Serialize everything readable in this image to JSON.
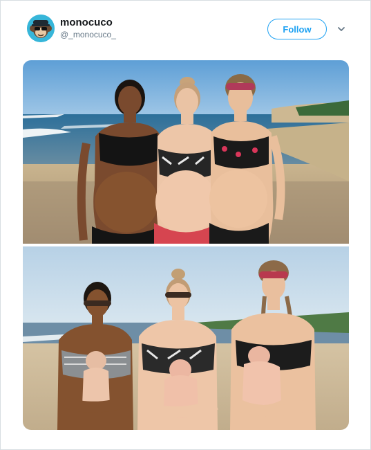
{
  "account": {
    "display_name": "monocuco",
    "handle": "@_monocuco_",
    "avatar_icon": "cartoon-monkey-avatar-icon"
  },
  "actions": {
    "follow_label": "Follow",
    "more_icon": "chevron-down-icon"
  },
  "colors": {
    "accent": "#1da1f2",
    "name_text": "#14171a",
    "secondary_text": "#657786",
    "avatar_bg": "#37b6d9"
  },
  "media": {
    "photos": [
      "before-photo",
      "after-photo"
    ]
  }
}
